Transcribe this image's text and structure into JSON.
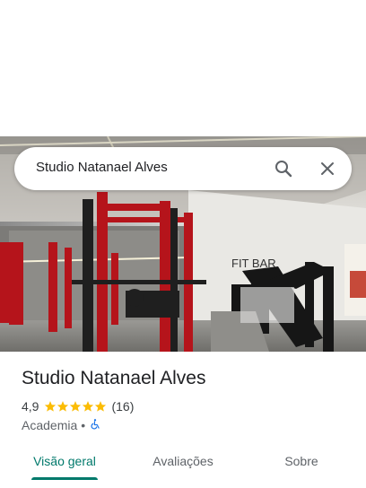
{
  "search": {
    "query": "Studio Natanael Alves"
  },
  "photo": {
    "sign_text": "FIT BAR"
  },
  "place": {
    "name": "Studio Natanael Alves",
    "rating": "4,9",
    "stars": 5,
    "review_count": "(16)",
    "category": "Academia",
    "separator": "•"
  },
  "tabs": [
    {
      "label": "Visão geral",
      "active": true
    },
    {
      "label": "Avaliações",
      "active": false
    },
    {
      "label": "Sobre",
      "active": false
    }
  ],
  "colors": {
    "accent": "#00796b",
    "star": "#fbbc04",
    "accessibility": "#1a73e8"
  },
  "icons": [
    "search-icon",
    "close-icon",
    "star-icon",
    "wheelchair-icon"
  ]
}
